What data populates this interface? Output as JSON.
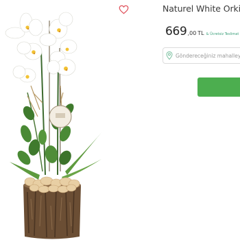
{
  "product": {
    "title": "Naturel White Orkid",
    "price_integer": "669",
    "price_decimal": ",00",
    "currency": "TL",
    "shipping_note": "& Ücretsiz Teslimat"
  },
  "delivery": {
    "placeholder": "Göndereceğiniz mahalleyi, i"
  },
  "icons": {
    "favorite": "heart-outline-icon",
    "location": "location-pin-icon"
  },
  "colors": {
    "accent_green": "#4cae4f",
    "favorite_red": "#e0525c",
    "location_icon": "#7dc1a1"
  }
}
